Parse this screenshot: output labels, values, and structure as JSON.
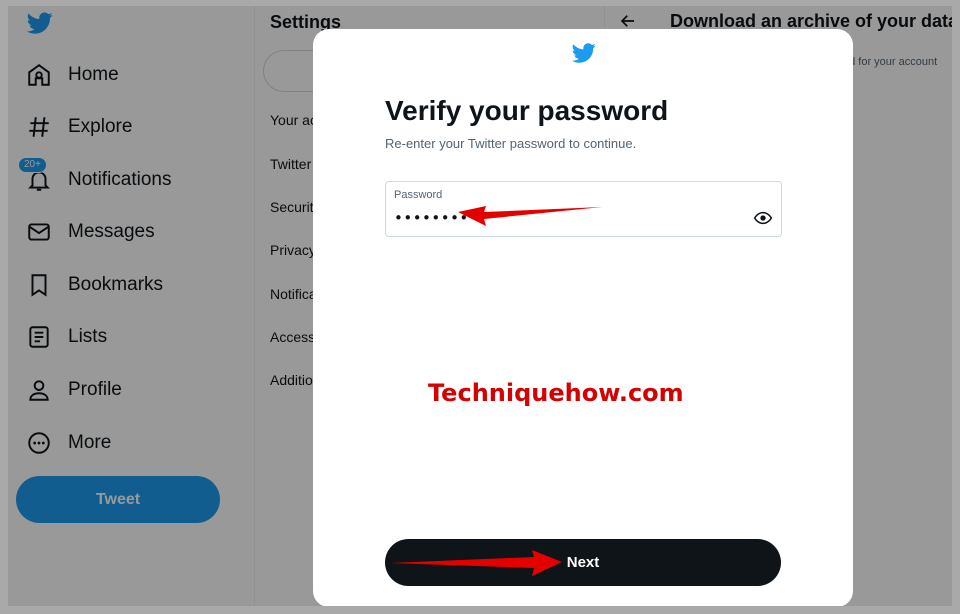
{
  "nav": {
    "items": [
      {
        "label": "Home",
        "icon": "home-icon"
      },
      {
        "label": "Explore",
        "icon": "hashtag-icon"
      },
      {
        "label": "Notifications",
        "icon": "bell-icon",
        "badge": "20+"
      },
      {
        "label": "Messages",
        "icon": "envelope-icon"
      },
      {
        "label": "Bookmarks",
        "icon": "bookmark-icon"
      },
      {
        "label": "Lists",
        "icon": "list-icon"
      },
      {
        "label": "Profile",
        "icon": "person-icon"
      },
      {
        "label": "More",
        "icon": "more-circle-icon"
      }
    ],
    "tweet_label": "Tweet"
  },
  "settings": {
    "title": "Settings",
    "items": [
      "Your ac",
      "Twitter",
      "Securit",
      "Privacy",
      "Notifica",
      "Access",
      "Additio"
    ]
  },
  "detail": {
    "title": "Download an archive of your data",
    "subtitle": "ed for your account"
  },
  "modal": {
    "title": "Verify your password",
    "subtitle": "Re-enter your Twitter password to continue.",
    "password_label": "Password",
    "password_value": "•••••••••",
    "next_label": "Next"
  },
  "watermark": "Techniquehow.com",
  "colors": {
    "brand": "#1d9bf0",
    "text": "#0f1419",
    "muted": "#536471",
    "annotation_arrow": "#e50000"
  }
}
